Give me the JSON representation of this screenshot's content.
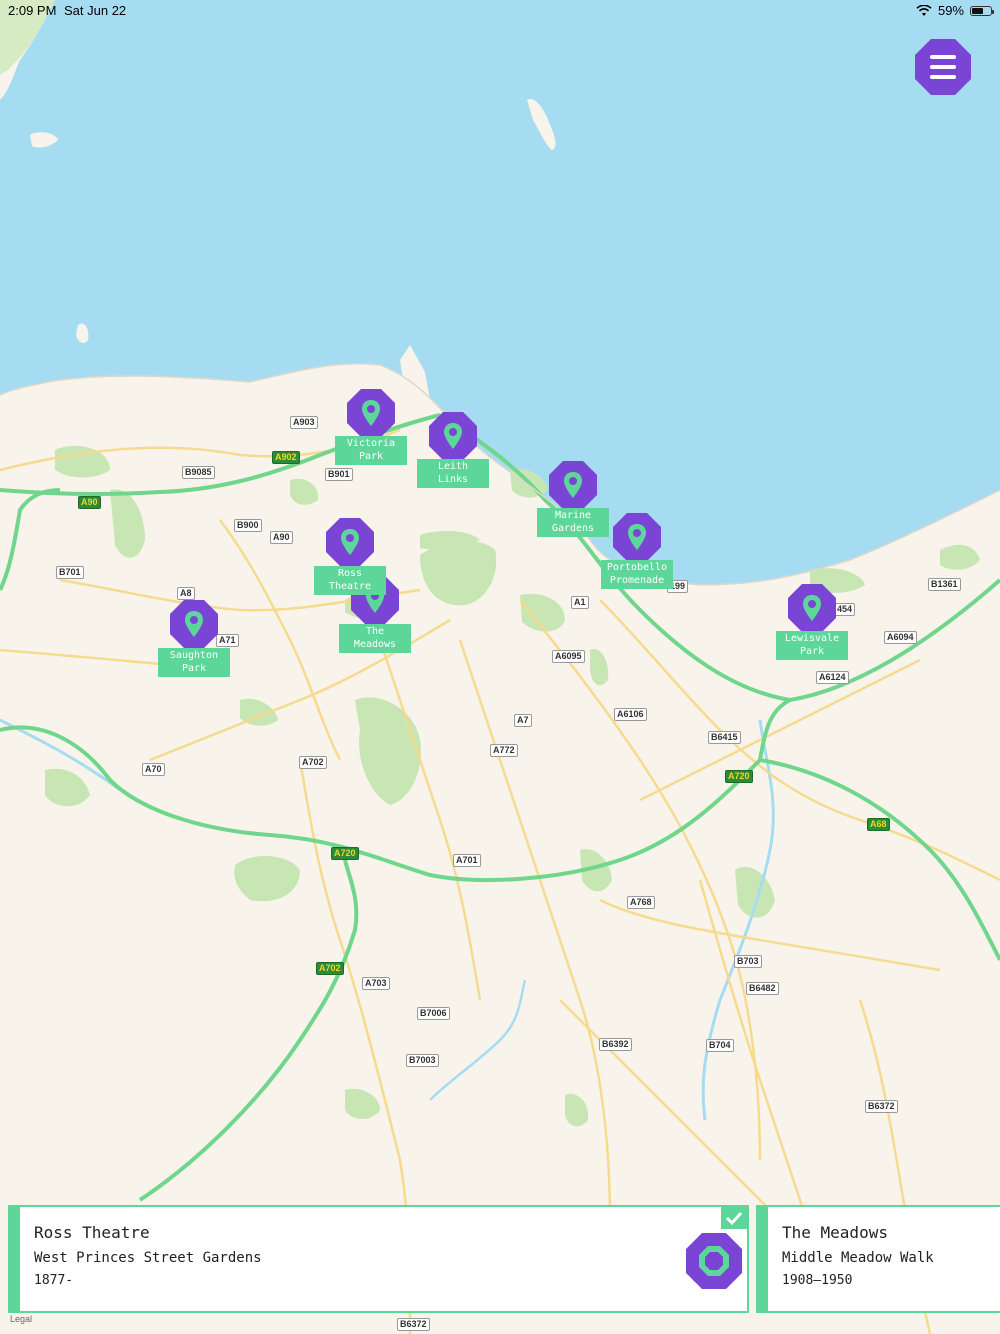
{
  "status_bar": {
    "time": "2:09 PM",
    "date": "Sat Jun 22",
    "battery": "59%",
    "battery_level": 0.59
  },
  "menu": {
    "icon": "menu-icon"
  },
  "map": {
    "legal": "Legal",
    "road_labels": [
      {
        "text": "A903",
        "major": false
      },
      {
        "text": "A902",
        "major": true
      },
      {
        "text": "B901",
        "major": false
      },
      {
        "text": "B9085",
        "major": false
      },
      {
        "text": "A90",
        "major": true
      },
      {
        "text": "B900",
        "major": false
      },
      {
        "text": "A90",
        "major": false
      },
      {
        "text": "B701",
        "major": false
      },
      {
        "text": "A8",
        "major": false
      },
      {
        "text": "A71",
        "major": false
      },
      {
        "text": "A70",
        "major": false
      },
      {
        "text": "A702",
        "major": false
      },
      {
        "text": "A720",
        "major": true
      },
      {
        "text": "A702",
        "major": true
      },
      {
        "text": "A703",
        "major": false
      },
      {
        "text": "B7006",
        "major": false
      },
      {
        "text": "B7003",
        "major": false
      },
      {
        "text": "A701",
        "major": false
      },
      {
        "text": "A772",
        "major": false
      },
      {
        "text": "A7",
        "major": false
      },
      {
        "text": "A6095",
        "major": false
      },
      {
        "text": "A1",
        "major": false
      },
      {
        "text": "A6106",
        "major": false
      },
      {
        "text": "B6415",
        "major": false
      },
      {
        "text": "A720",
        "major": true
      },
      {
        "text": "A768",
        "major": false
      },
      {
        "text": "B703",
        "major": false
      },
      {
        "text": "B6482",
        "major": false
      },
      {
        "text": "B6392",
        "major": false
      },
      {
        "text": "B704",
        "major": false
      },
      {
        "text": "B6372",
        "major": false
      },
      {
        "text": "A6124",
        "major": false
      },
      {
        "text": "A6094",
        "major": false
      },
      {
        "text": "B1361",
        "major": false
      },
      {
        "text": "A68",
        "major": true
      },
      {
        "text": "B6372",
        "major": false
      },
      {
        "text": "199",
        "major": false
      },
      {
        "text": "454",
        "major": false
      }
    ],
    "markers": [
      {
        "id": "victoria-park",
        "lines": [
          "Victoria",
          "Park"
        ]
      },
      {
        "id": "leith-links",
        "lines": [
          "Leith",
          "Links"
        ]
      },
      {
        "id": "marine-gardens",
        "lines": [
          "Marine",
          "Gardens"
        ]
      },
      {
        "id": "portobello-promenade",
        "lines": [
          "Portobello",
          "Promenade"
        ]
      },
      {
        "id": "ross-theatre",
        "lines": [
          "Ross",
          "Theatre"
        ]
      },
      {
        "id": "the-meadows",
        "lines": [
          "The",
          "Meadows"
        ]
      },
      {
        "id": "saughton-park",
        "lines": [
          "Saughton",
          "Park"
        ]
      },
      {
        "id": "lewisvale-park",
        "lines": [
          "Lewisvale",
          "Park"
        ]
      }
    ],
    "colors": {
      "water": "#a6dcf2",
      "land": "#f8f4ec",
      "park": "#c8e6b4",
      "motorway": "#6fd68b",
      "road": "#f6d98a",
      "marker": "#7a45d4",
      "label": "#5dd69a"
    }
  },
  "cards": [
    {
      "title": "Ross Theatre",
      "subtitle": "West Princes Street Gardens",
      "years": "1877-",
      "selected": true
    },
    {
      "title": "The Meadows",
      "subtitle": "Middle Meadow Walk",
      "years": "1908–1950",
      "selected": false
    }
  ]
}
